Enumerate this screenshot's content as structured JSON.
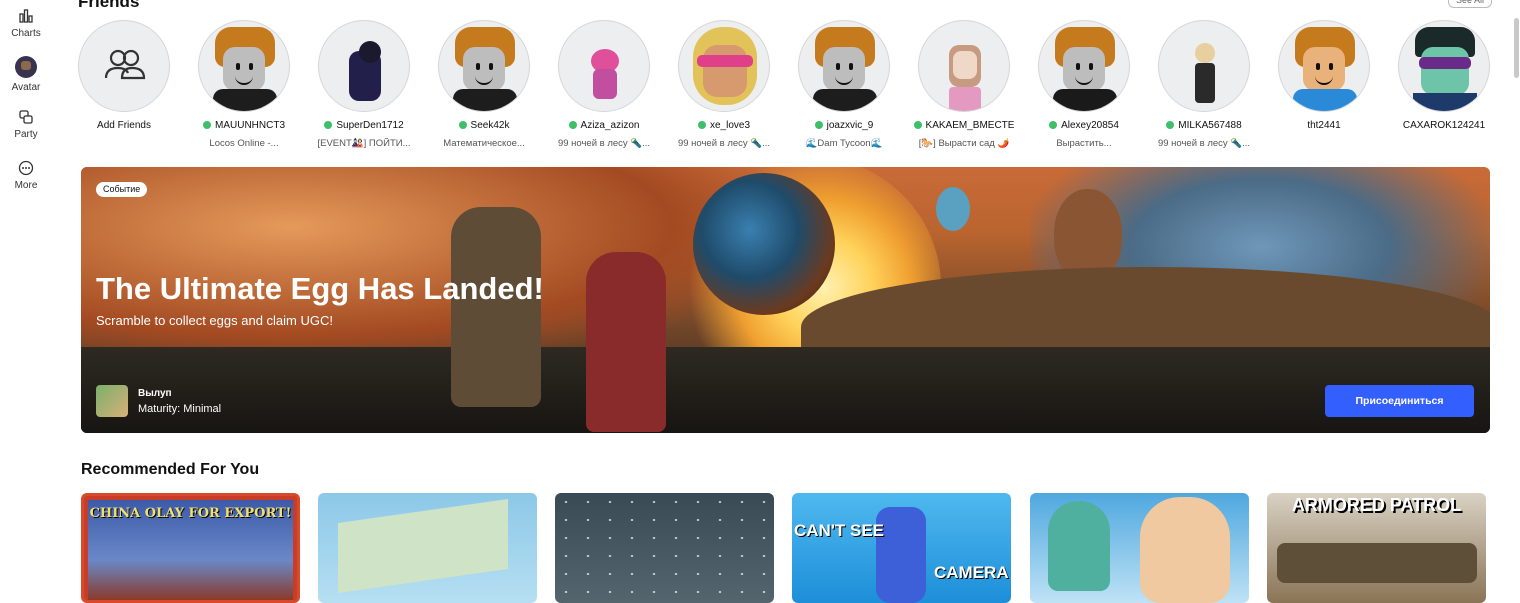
{
  "nav": {
    "items": [
      {
        "label": "Charts",
        "icon": "charts-icon"
      },
      {
        "label": "Avatar",
        "icon": "avatar-icon"
      },
      {
        "label": "Party",
        "icon": "party-icon"
      },
      {
        "label": "More",
        "icon": "more-icon"
      }
    ]
  },
  "friends": {
    "title": "Friends",
    "see_all": "See All",
    "add_label": "Add Friends",
    "list": [
      {
        "name": "MAUUNHNCT3",
        "game": "Locos Online -...",
        "online": true
      },
      {
        "name": "SuperDen1712",
        "game": "[EVENT🎎] ПОЙТИ...",
        "online": true
      },
      {
        "name": "Seek42k",
        "game": "Математическое...",
        "online": true
      },
      {
        "name": "Aziza_azizon",
        "game": "99 ночей в лесу 🔦...",
        "online": true
      },
      {
        "name": "xe_love3",
        "game": "99 ночей в лесу 🔦...",
        "online": true
      },
      {
        "name": "joazxvic_9",
        "game": "🌊Dam Tycoon🌊",
        "online": true
      },
      {
        "name": "KAKAEM_BMECTE",
        "game": "[🐎] Вырасти сад 🌶️",
        "online": true
      },
      {
        "name": "Alexey20854",
        "game": "Вырастить...",
        "online": true
      },
      {
        "name": "MILKA567488",
        "game": "99 ночей в лесу 🔦...",
        "online": true
      },
      {
        "name": "tht2441",
        "game": "",
        "online": false
      },
      {
        "name": "CAXAROK124241",
        "game": "",
        "online": false
      }
    ]
  },
  "banner": {
    "badge": "Событие",
    "title": "The Ultimate Egg Has Landed!",
    "subtitle": "Scramble to collect eggs and claim UGC!",
    "game_name": "Вылуп",
    "maturity": "Maturity: Minimal",
    "join_label": "Присоединиться",
    "join_color": "#335fff"
  },
  "recommended": {
    "title": "Recommended For You",
    "tiles": [
      {
        "caption": "CHINA OLAY FOR EXPORT!"
      },
      {
        "caption": ""
      },
      {
        "caption": ""
      },
      {
        "caption_a": "CAN'T SEE",
        "caption_b": "CAMERA"
      },
      {
        "caption": ""
      },
      {
        "caption": "ARMORED PATROL"
      }
    ]
  }
}
